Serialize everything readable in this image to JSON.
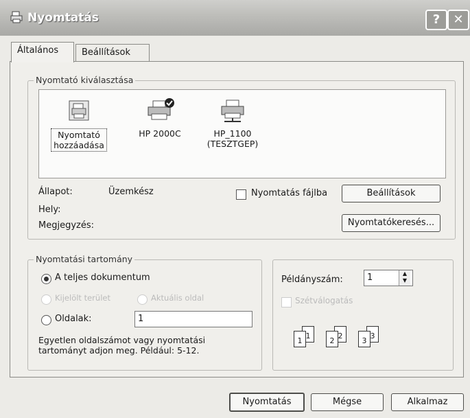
{
  "window": {
    "title": "Nyomtatás",
    "help_glyph": "?",
    "close_glyph": "✕"
  },
  "tabs": [
    {
      "label": "Általános"
    },
    {
      "label": "Beállítások"
    }
  ],
  "printer_select": {
    "group_label": "Nyomtató kiválasztása",
    "printers": [
      {
        "line1": "Nyomtató",
        "line2": "hozzáadása"
      },
      {
        "line1": "HP 2000C",
        "line2": ""
      },
      {
        "line1": "HP_1100",
        "line2": "(TESZTGEP)"
      }
    ],
    "status_label": "Állapot:",
    "status_value": "Üzemkész",
    "location_label": "Hely:",
    "comment_label": "Megjegyzés:",
    "print_to_file_label": "Nyomtatás fájlba",
    "settings_button": "Beállítások",
    "find_printer_button": "Nyomtatókeresés..."
  },
  "range": {
    "group_label": "Nyomtatási tartomány",
    "all_label": "A teljes dokumentum",
    "selection_label": "Kijelölt terület",
    "current_page_label": "Aktuális oldal",
    "pages_label": "Oldalak:",
    "pages_value": "1",
    "hint": "Egyetlen oldalszámot vagy nyomtatási tartományt adjon meg. Például: 5-12."
  },
  "copies": {
    "label": "Példányszám:",
    "value": "1",
    "collate_label": "Szétválogatás",
    "page_numbers": [
      "1",
      "1",
      "2",
      "2",
      "3",
      "3"
    ]
  },
  "buttons": {
    "print": "Nyomtatás",
    "cancel": "Mégse",
    "apply": "Alkalmaz"
  }
}
